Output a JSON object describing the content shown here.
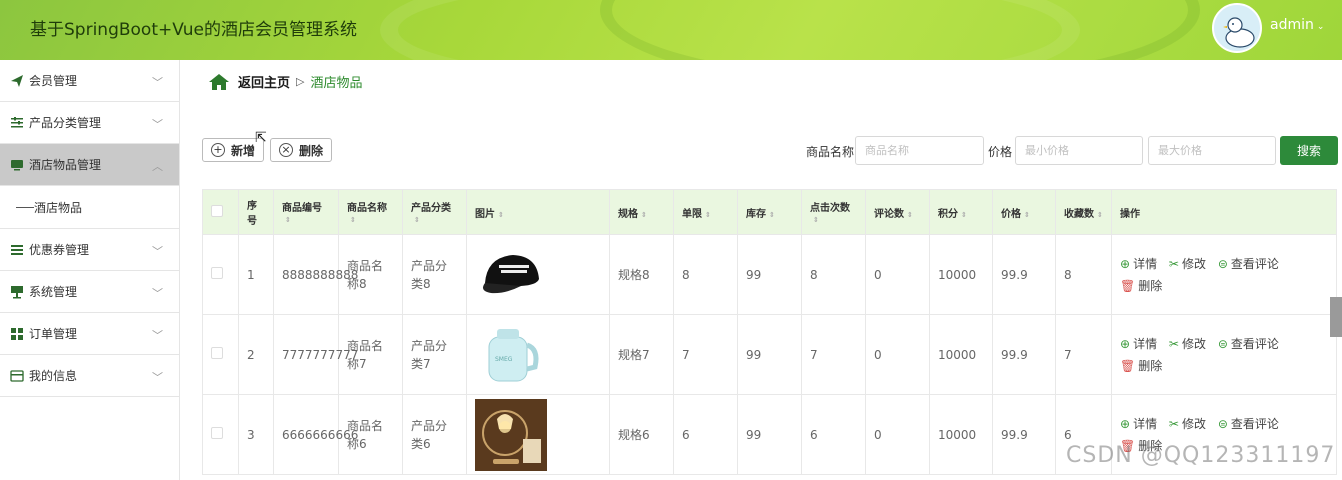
{
  "header": {
    "title": "基于SpringBoot+Vue的酒店会员管理系统",
    "user": "admin",
    "avatar_icon": "duck-avatar"
  },
  "sidebar": {
    "items": [
      {
        "label": "会员管理",
        "icon": "send-icon"
      },
      {
        "label": "产品分类管理",
        "icon": "sliders-icon"
      },
      {
        "label": "酒店物品管理",
        "icon": "monitor-icon",
        "active": true,
        "children": [
          {
            "label": "酒店物品"
          }
        ]
      },
      {
        "label": "优惠券管理",
        "icon": "list-icon"
      },
      {
        "label": "系统管理",
        "icon": "display-icon"
      },
      {
        "label": "订单管理",
        "icon": "grid-icon"
      },
      {
        "label": "我的信息",
        "icon": "card-icon"
      }
    ]
  },
  "breadcrumb": {
    "home": "返回主页",
    "current": "酒店物品"
  },
  "toolbar": {
    "add_label": "新增",
    "delete_label": "删除",
    "name_label": "商品名称",
    "name_placeholder": "商品名称",
    "price_label": "价格",
    "min_price_placeholder": "最小价格",
    "max_price_placeholder": "最大价格",
    "search_label": "搜索"
  },
  "table": {
    "headers": [
      "序号",
      "商品编号",
      "商品名称",
      "产品分类",
      "图片",
      "规格",
      "单限",
      "库存",
      "点击次数",
      "评论数",
      "积分",
      "价格",
      "收藏数",
      "操作"
    ],
    "rows": [
      {
        "index": "1",
        "code": "8888888888",
        "name": "商品名称8",
        "category": "产品分类8",
        "image": "black-cap",
        "spec": "规格8",
        "limit": "8",
        "stock": "99",
        "clicks": "8",
        "comments": "0",
        "points": "10000",
        "price": "99.9",
        "favorites": "8"
      },
      {
        "index": "2",
        "code": "7777777777",
        "name": "商品名称7",
        "category": "产品分类7",
        "image": "electric-kettle",
        "spec": "规格7",
        "limit": "7",
        "stock": "99",
        "clicks": "7",
        "comments": "0",
        "points": "10000",
        "price": "99.9",
        "favorites": "7"
      },
      {
        "index": "3",
        "code": "6666666666",
        "name": "商品名称6",
        "category": "产品分类6",
        "image": "table-lamp",
        "spec": "规格6",
        "limit": "6",
        "stock": "99",
        "clicks": "6",
        "comments": "0",
        "points": "10000",
        "price": "99.9",
        "favorites": "6"
      }
    ],
    "actions": {
      "detail": "详情",
      "edit": "修改",
      "view_comments": "查看评论",
      "delete": "删除"
    }
  },
  "watermark": "CSDN @QQ123311197",
  "colors": {
    "header": "#a8d83a",
    "primary": "#2d8a3a",
    "table_header": "#eaf7e0",
    "active_menu": "#c9c9c9"
  }
}
